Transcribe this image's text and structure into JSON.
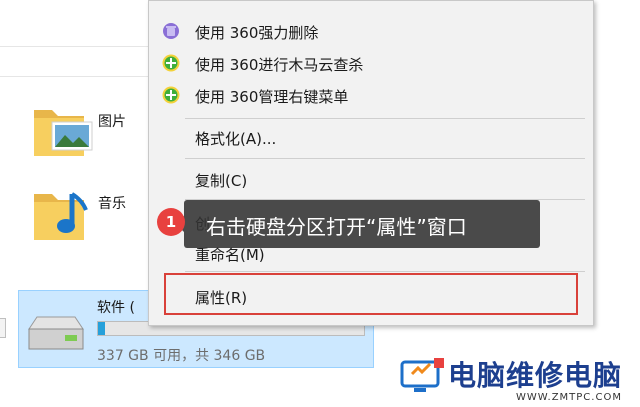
{
  "explorer": {
    "folders": [
      {
        "label": "图片",
        "icon": "pictures-folder-icon"
      },
      {
        "label": "音乐",
        "icon": "music-folder-icon"
      }
    ],
    "drive": {
      "name": "软件 (",
      "space_text": "337 GB 可用，共 346 GB",
      "used_fraction": 0.026,
      "icon": "hard-drive-icon"
    }
  },
  "context_menu": {
    "items": [
      {
        "label": "使用 360强力删除",
        "icon": "360-purple-icon"
      },
      {
        "label": "使用 360进行木马云查杀",
        "icon": "360-green-plus-icon"
      },
      {
        "label": "使用 360管理右键菜单",
        "icon": "360-green-plus-icon"
      },
      {
        "label": "格式化(A)..."
      },
      {
        "label": "复制(C)"
      },
      {
        "label": "创"
      },
      {
        "label": "重命名(M)"
      },
      {
        "label": "属性(R)"
      }
    ]
  },
  "callout": {
    "step": "1",
    "text": "右击硬盘分区打开“属性”窗口"
  },
  "watermark": {
    "text": "电脑维修电脑",
    "url": "WWW.ZMTPC.COM"
  },
  "colors": {
    "highlight_border": "#d9413a",
    "badge": "#e8413f",
    "drive_selection": "#cce8ff",
    "drive_bar": "#26a0da"
  }
}
